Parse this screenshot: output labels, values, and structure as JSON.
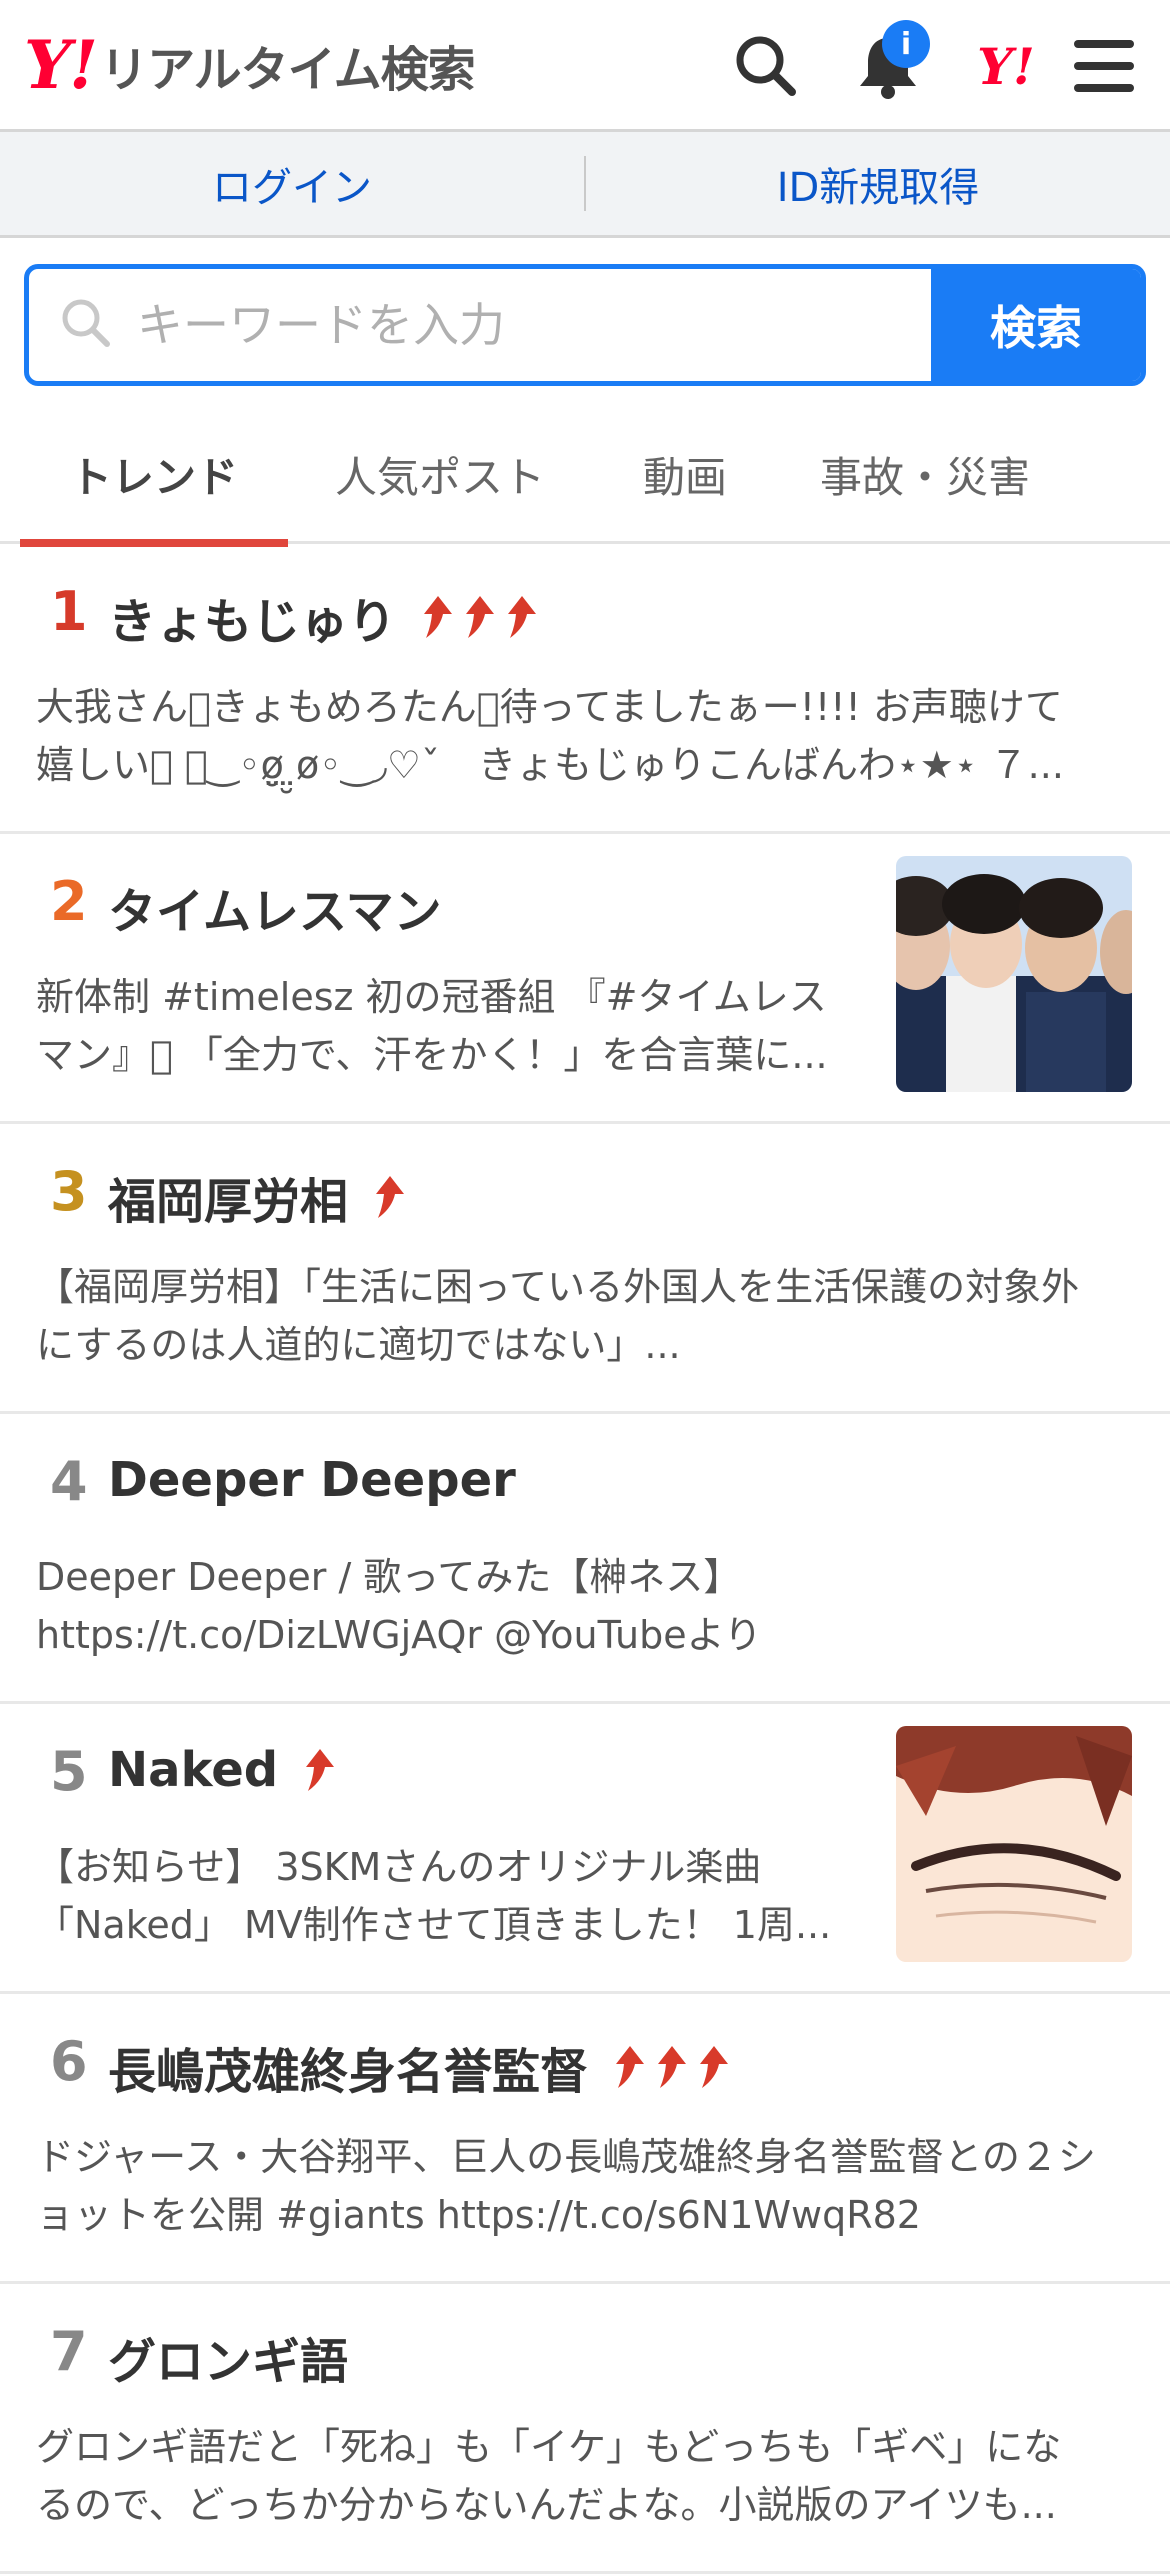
{
  "header": {
    "logo_y": "Y!",
    "logo_text": "リアルタイム検索",
    "notification_badge": "i",
    "yahoo_mark": "Y!"
  },
  "auth": {
    "login": "ログイン",
    "register": "ID新規取得"
  },
  "search": {
    "placeholder": "キーワードを入力",
    "button": "検索"
  },
  "tabs": [
    "トレンド",
    "人気ポスト",
    "動画",
    "事故・災害"
  ],
  "trends": [
    {
      "rank": "1",
      "title": "きょもじゅり",
      "arrows": 3,
      "snippet": "大我さん􀀀きょもめろたん􀀀待ってましたぁー!!!! お声聴けて嬉しい􀀀 􀀀‿◦ø̤̮ ̤̮ø◦‿◞♡ˇ　きょもじゅりこんばんわ⋆★⋆ ７..."
    },
    {
      "rank": "2",
      "title": "タイムレスマン",
      "arrows": 0,
      "snippet": "新体制 #timelesz 初の冠番組 『#タイムレスマン』􀀀 「全力で、汗をかく！」を合言葉に..."
    },
    {
      "rank": "3",
      "title": "福岡厚労相",
      "arrows": 1,
      "snippet": "【福岡厚労相】「生活に困っている外国人を生活保護の対象外にするのは人道的に適切ではない」..."
    },
    {
      "rank": "4",
      "title": "Deeper Deeper",
      "arrows": 0,
      "snippet": "Deeper Deeper / 歌ってみた【榊ネス】 https://t.co/DizLWGjAQr @YouTubeより"
    },
    {
      "rank": "5",
      "title": "Naked",
      "arrows": 1,
      "snippet": "【お知らせ】 3SKMさんのオリジナル楽曲「Naked」 MV制作させて頂きました！ 1周..."
    },
    {
      "rank": "6",
      "title": "長嶋茂雄終身名誉監督",
      "arrows": 3,
      "snippet": "ドジャース・大谷翔平、巨人の長嶋茂雄終身名誉監督との２ショットを公開 #giants https://t.co/s6N1WwqR82"
    },
    {
      "rank": "7",
      "title": "グロンギ語",
      "arrows": 0,
      "snippet": "グロンギ語だと「死ね」も「イケ」もどっちも「ギベ」になるので、どっちか分からないんだよな。小説版のアイツも..."
    }
  ],
  "colors": {
    "accent": "#1a7cf5",
    "brand_red": "#ff0033",
    "active_tab": "#e0463c",
    "rank1": "#d63a2a",
    "rank2": "#ea6a28",
    "rank3": "#c59120"
  }
}
